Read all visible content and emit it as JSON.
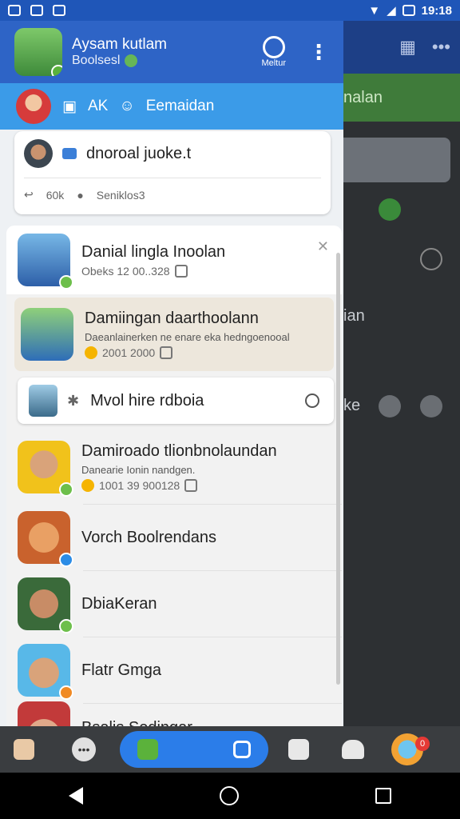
{
  "status": {
    "time": "19:18"
  },
  "background_app": {
    "banner_text": "nalan",
    "text_1": "ian",
    "text_2": "ke"
  },
  "drawer": {
    "user_name": "Aysam kutlam",
    "user_status": "Boolsesl",
    "action_label": "Meltur",
    "subheader": {
      "a": "AK",
      "b": "Eemaidan"
    },
    "post": {
      "text": "dnoroal juoke.t",
      "count": "60k",
      "reply": "Seniklos3"
    },
    "chats": [
      {
        "name": "Danial lingla Inoolan",
        "sub": "Obeks 12 00..328",
        "meta": ""
      },
      {
        "name": "Damiingan daarthoolann",
        "sub": "Daeanlainerken ne enare eka hedngoenooal",
        "meta": "2001  2000"
      },
      {
        "name": "Mvol hire rdboia",
        "sub": "",
        "meta": ""
      },
      {
        "name": "Damiroado tlionbnolaundan",
        "sub": "Danearie Ionin          nandgen.",
        "meta": "1001 39 900128"
      },
      {
        "name": "Vorch Boolrendans",
        "sub": "",
        "meta": ""
      },
      {
        "name": "DbiaKeran",
        "sub": "",
        "meta": ""
      },
      {
        "name": "Flatr Gmga",
        "sub": "",
        "meta": ""
      },
      {
        "name": "Bsalis Sedingar",
        "sub": "",
        "meta": ""
      }
    ]
  },
  "bottom_nav": {
    "notif_count": "0"
  },
  "colors": {
    "header_blue": "#2e64c6",
    "sub_blue": "#3b9be8",
    "pill_blue": "#2b7de9"
  }
}
